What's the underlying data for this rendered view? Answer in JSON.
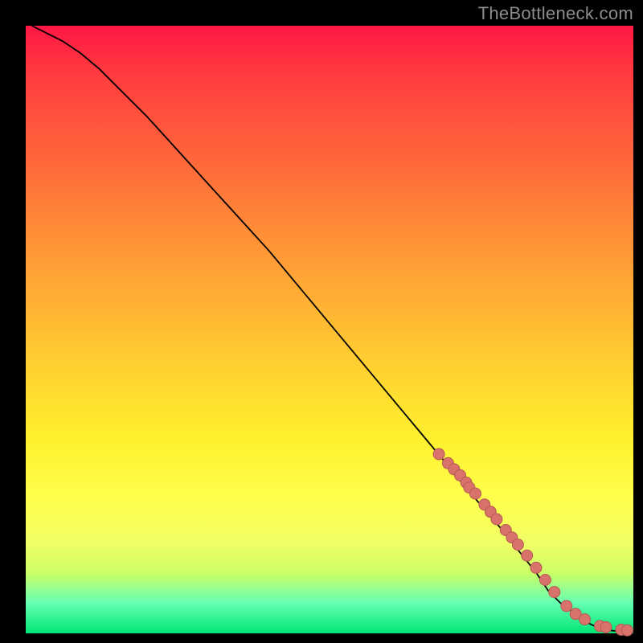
{
  "watermark": "TheBottleneck.com",
  "chart_data": {
    "type": "line",
    "title": "",
    "xlabel": "",
    "ylabel": "",
    "xlim": [
      0,
      100
    ],
    "ylim": [
      0,
      100
    ],
    "curve": {
      "x": [
        1,
        3,
        6,
        9,
        12,
        15,
        20,
        25,
        30,
        35,
        40,
        45,
        50,
        55,
        60,
        65,
        70,
        72,
        75,
        78,
        80,
        82,
        84,
        85,
        86,
        88,
        90,
        92,
        94,
        96,
        98,
        100
      ],
      "y": [
        100,
        99,
        97.5,
        95.5,
        93,
        90,
        85,
        79.5,
        74,
        68.5,
        63,
        57,
        51,
        45,
        39,
        33,
        27,
        24.5,
        21,
        17.5,
        15,
        12.5,
        10,
        8.5,
        7,
        5,
        3.5,
        2,
        1,
        0.5,
        0.3,
        0.2
      ]
    },
    "scatter": {
      "x": [
        68,
        69.5,
        70.5,
        71.5,
        72.5,
        73,
        74,
        75.5,
        76.5,
        77.5,
        79,
        80,
        81,
        82.5,
        84,
        85.5,
        87,
        89,
        90.5,
        92,
        94.5,
        95.5,
        98,
        99
      ],
      "y": [
        29.5,
        28,
        27,
        26,
        24.8,
        24,
        23,
        21.2,
        20,
        18.8,
        17,
        15.8,
        14.6,
        12.8,
        10.8,
        8.8,
        6.8,
        4.5,
        3.2,
        2.3,
        1.2,
        1,
        0.6,
        0.5
      ]
    }
  },
  "colors": {
    "curve": "#000000",
    "points_fill": "#d9726b",
    "points_stroke": "#b45a54",
    "watermark": "#8c8c8c",
    "background": "#000000"
  }
}
